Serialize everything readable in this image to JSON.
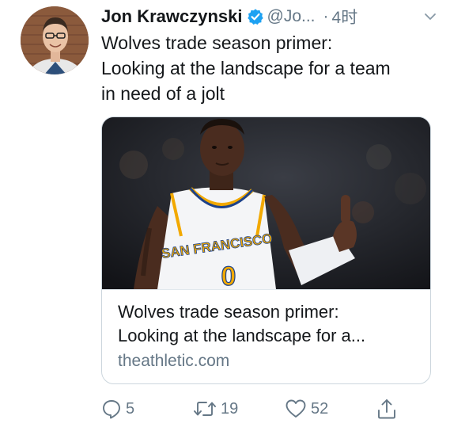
{
  "tweet": {
    "author_name": "Jon Krawczynski",
    "handle": "@Jo...",
    "separator": "·",
    "time": "4时",
    "text_line1": "Wolves trade season primer:",
    "text_line2": "Looking at the landscape for a team",
    "text_line3": "in need of a jolt"
  },
  "card": {
    "title_line1": "Wolves trade season primer:",
    "title_line2": "Looking at the landscape for a...",
    "domain": "theathletic.com",
    "jersey_text": "SAN FRANCISCO",
    "jersey_number": "0"
  },
  "actions": {
    "reply_count": "5",
    "retweet_count": "19",
    "like_count": "52"
  },
  "icons": {
    "verified": "verified-badge-icon",
    "chevron": "chevron-down-icon",
    "reply": "reply-icon",
    "retweet": "retweet-icon",
    "like": "heart-icon",
    "share": "share-icon"
  },
  "colors": {
    "text": "#14171a",
    "secondary": "#657786",
    "verified": "#1da1f2",
    "border": "#ccd6dd"
  }
}
